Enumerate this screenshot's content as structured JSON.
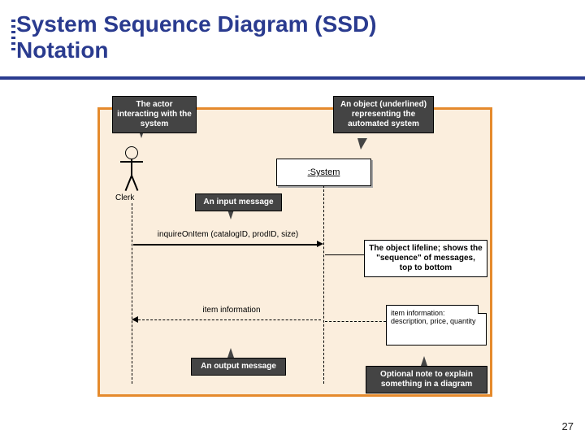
{
  "title_line1": "System Sequence Diagram (SSD)",
  "title_line2": "Notation",
  "actor_label": "Clerk",
  "system_label": ":System",
  "callouts": {
    "actor_desc": "The actor interacting with the system",
    "object_desc": "An object (underlined) representing the automated system",
    "input_msg": "An input message",
    "lifeline_desc": "The object lifeline; shows the \"sequence\" of messages, top to bottom",
    "output_msg": "An output message",
    "note_desc": "Optional note to explain something in a diagram"
  },
  "messages": {
    "input": "inquireOnItem (catalogID, prodID, size)",
    "output": "item information"
  },
  "note_text": "item information:\ndescription, price, quantity",
  "page_number": "27"
}
